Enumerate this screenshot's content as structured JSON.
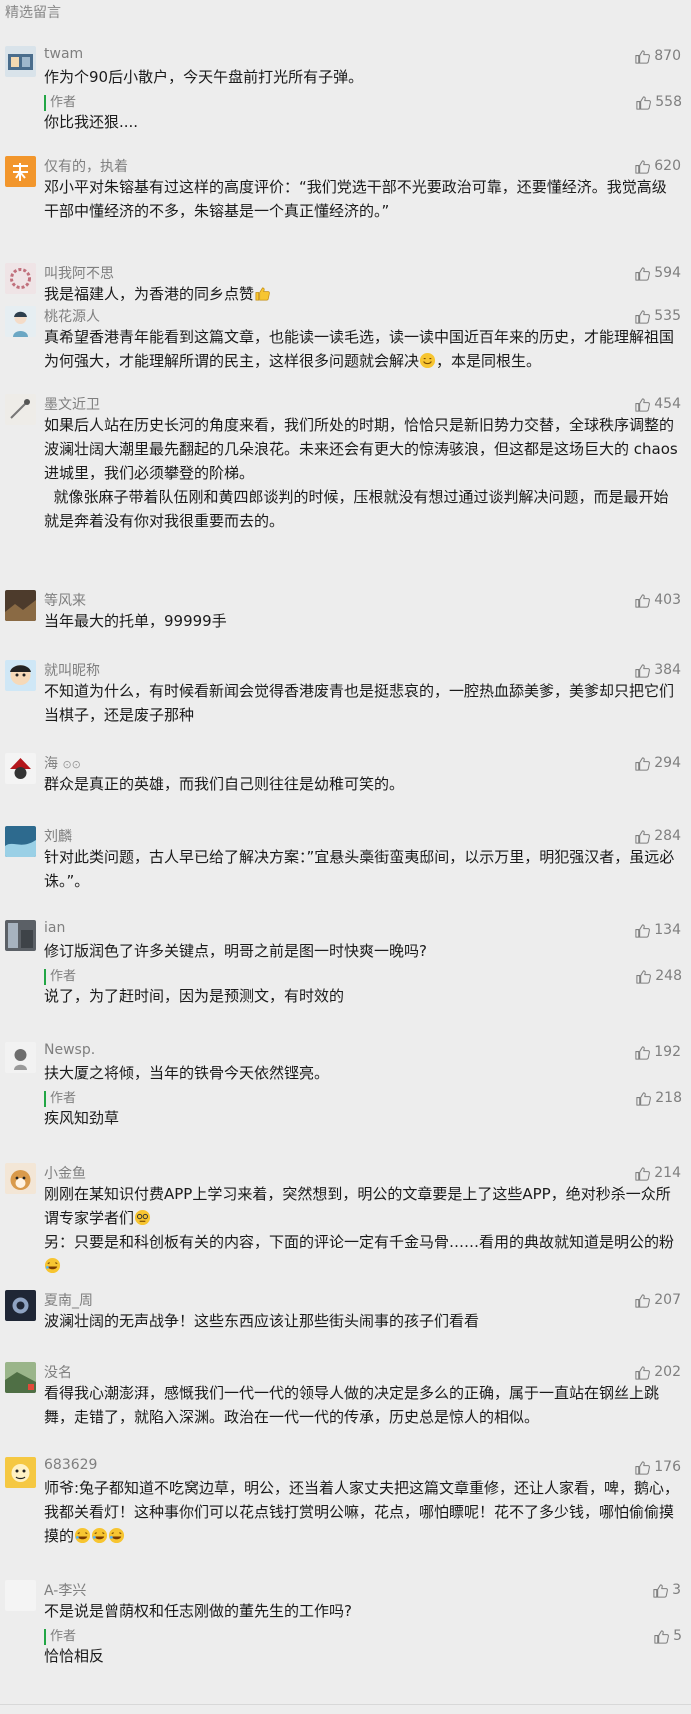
{
  "section_title": "精选留言",
  "author_label": "作者",
  "colors": {
    "accent": "#22a645",
    "muted": "#7f7f7f",
    "text": "#1a1a1a",
    "background": "#ededed"
  },
  "icons": {
    "like": "thumbs-up-icon"
  },
  "comments": [
    {
      "nick": "twam",
      "likes": "870",
      "text": "作为个90后小散户，今天午盘前打光所有子弹。",
      "reply": {
        "likes": "558",
        "text": "你比我还狠...."
      }
    },
    {
      "nick": "仅有的，执着",
      "likes": "620",
      "text": "邓小平对朱镕基有过这样的高度评价：“我们党选干部不光要政治可靠，还要懂经济。我觉高级干部中懂经济的不多，朱镕基是一个真正懂经济的。”"
    },
    {
      "nick": "叫我阿不思",
      "likes": "594",
      "text": "我是福建人，为香港的同乡点赞"
    },
    {
      "nick": "桃花源人",
      "likes": "535",
      "text": "真希望香港青年能看到这篇文章，也能读一读毛选，读一读中国近百年来的历史，才能理解祖国为何强大，才能理解所谓的民主，这样很多问题就会解决",
      "text_after": "，本是同根生。"
    },
    {
      "nick": "墨文近卫",
      "likes": "454",
      "text": "如果后人站在历史长河的角度来看，我们所处的时期，恰恰只是新旧势力交替，全球秩序调整的波澜壮阔大潮里最先翻起的几朵浪花。未来还会有更大的惊涛骇浪，但这都是这场巨大的 chaos 进城里，我们必须攀登的阶梯。\n  就像张麻子带着队伍刚和黄四郎谈判的时候，压根就没有想过通过谈判解决问题，而是最开始就是奔着没有你对我很重要而去的。"
    },
    {
      "nick": "等风来",
      "likes": "403",
      "text": "当年最大的托单，99999手"
    },
    {
      "nick": "就叫昵称",
      "likes": "384",
      "text": "不知道为什么，有时候看新闻会觉得香港废青也是挺悲哀的，一腔热血舔美爹，美爹却只把它们当棋子，还是废子那种"
    },
    {
      "nick": "海",
      "likes": "294",
      "text": "群众是真正的英雄，而我们自己则往往是幼稚可笑的。"
    },
    {
      "nick": "刘麟",
      "likes": "284",
      "text": "针对此类问题，古人早已给了解决方案：”宜悬头槀街蛮夷邸间，以示万里，明犯强汉者，虽远必诛。”。"
    },
    {
      "nick": "ian",
      "likes": "134",
      "text": "修订版润色了许多关键点，明哥之前是图一时快爽一晚吗?",
      "reply": {
        "likes": "248",
        "text": "说了，为了赶时间，因为是预测文，有时效的"
      }
    },
    {
      "nick": "Newsp.",
      "likes": "192",
      "text": "扶大厦之将倾，当年的铁骨今天依然铿亮。",
      "reply": {
        "likes": "218",
        "text": "疾风知劲草"
      }
    },
    {
      "nick": "小金鱼",
      "likes": "214",
      "text": "刚刚在某知识付费APP上学习来着，突然想到，明公的文章要是上了这些APP，绝对秒杀一众所谓专家学者们",
      "text_line2": "另：只要是和科创板有关的内容，下面的评论一定有千金马骨……看用的典故就知道是明公的粉"
    },
    {
      "nick": "夏南_周",
      "likes": "207",
      "text": "波澜壮阔的无声战争！这些东西应该让那些街头闹事的孩子们看看"
    },
    {
      "nick": "没名",
      "likes": "202",
      "text": "看得我心潮澎湃，感慨我们一代一代的领导人做的决定是多么的正确，属于一直站在钢丝上跳舞，走错了，就陷入深渊。政治在一代一代的传承，历史总是惊人的相似。"
    },
    {
      "nick": "683629",
      "likes": "176",
      "text": "师爷:兔子都知道不吃窝边草，明公，还当着人家丈夫把这篇文章重修，还让人家看，啤，鹅心，我都关看灯！这种事你们可以花点钱打赏明公嘛，花点，哪怕瞟呢！花不了多少钱，哪怕偷偷摸摸的"
    },
    {
      "nick": "A-李兴",
      "likes": "3",
      "text": "不是说是曾荫权和任志刚做的董先生的工作吗?",
      "reply": {
        "likes": "5",
        "text": "恰恰相反"
      }
    }
  ]
}
